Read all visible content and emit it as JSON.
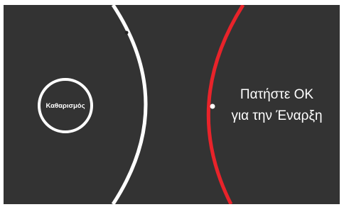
{
  "screen": {
    "background": "#333333",
    "mode_label": "Καθαρισμός",
    "prompt_line1": "Πατήστε ΟΚ",
    "prompt_line2": "για την Έναρξη"
  },
  "colors": {
    "ring": "#ffffff",
    "white_arc": "#ffffff",
    "red_arc": "#e8232a",
    "knob_dark": "#222222"
  }
}
